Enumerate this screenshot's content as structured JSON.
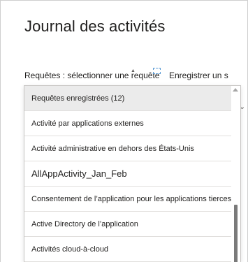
{
  "page": {
    "title": "Journal des activités",
    "query_label": "Requêtes : sélectionner une requête",
    "save_label": "Enregistrer un s"
  },
  "dropdown": {
    "items": [
      {
        "label": "Requêtes enregistrées (12)",
        "selected": true
      },
      {
        "label": "Activité par applications externes"
      },
      {
        "label": "Activité administrative en dehors des États-Unis"
      },
      {
        "label": "AllAppActivity_Jan_Feb"
      },
      {
        "label": "Consentement de l’application pour les applications tierces"
      },
      {
        "label": "Active Directory de l’application"
      },
      {
        "label": "Activités cloud-à-cloud"
      }
    ]
  },
  "icons": {
    "scroll_up": "chevron-up-icon",
    "behind_chevron": "chevron-down-icon",
    "caret": "caret-up-icon"
  }
}
